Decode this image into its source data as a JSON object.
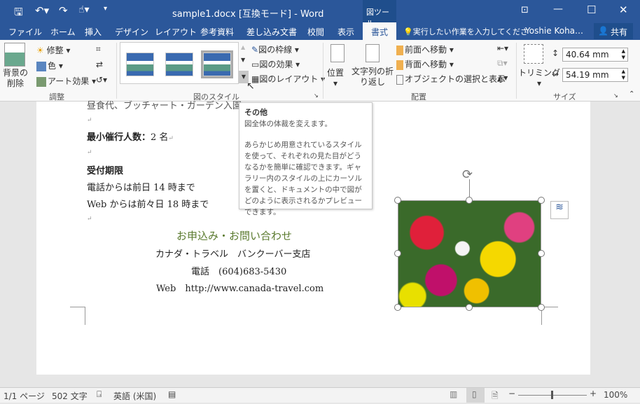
{
  "title": {
    "text": "sample1.docx [互換モード] - Word",
    "context_tab": "図ツール"
  },
  "tabs": [
    "ファイル",
    "ホーム",
    "挿入",
    "デザイン",
    "レイアウト",
    "参考資料",
    "差し込み文書",
    "校閲",
    "表示",
    "書式"
  ],
  "active_tab": "書式",
  "tell_me": "実行したい作業を入力してくださ",
  "user": "Yoshie Koha…",
  "share": "共有",
  "ribbon": {
    "remove_bg": "背景の削除",
    "corrections": "修整",
    "color": "色",
    "art_effects": "アート効果",
    "group_adjust": "調整",
    "border": "図の枠線",
    "effects": "図の効果",
    "layout": "図のレイアウト",
    "group_styles": "図のスタイル",
    "position": "位置",
    "wrap": "文字列の折り返し",
    "bring_forward": "前面へ移動",
    "send_backward": "背面へ移動",
    "selection_pane": "オブジェクトの選択と表示",
    "group_arrange": "配置",
    "crop": "トリミング",
    "height": "40.64 mm",
    "width": "54.19 mm",
    "group_size": "サイズ"
  },
  "tooltip": {
    "title": "その他",
    "subtitle": "図全体の体裁を変えます。",
    "body": "あらかじめ用意されているスタイルを使って、それぞれの見た目がどうなるかを簡単に確認できます。ギャラリー内のスタイルの上にカーソルを置くと、ドキュメントの中で図がどのように表示されるかプレビューできます。"
  },
  "document": {
    "line0": "昼食代、ブッチャート・ガーデン入園",
    "min_label": "最小催行人数：",
    "min_value": "2 名",
    "deadline": "受付期限",
    "phone_deadline": "電話からは前日 14 時まで",
    "web_deadline": "Web からは前々日 18 時まで",
    "contact_heading": "お申込み・お問い合わせ",
    "company": "カナダ・トラベル　バンクーバー支店",
    "phone": "電話　(604)683-5430",
    "web": "Web　http://www.canada-travel.com",
    "heading_color": "#5a7a2e"
  },
  "status": {
    "page": "1/1 ページ",
    "words": "502 文字",
    "language": "英語 (米国)",
    "zoom": "100%"
  },
  "colors": {
    "accent": "#2b579a"
  }
}
